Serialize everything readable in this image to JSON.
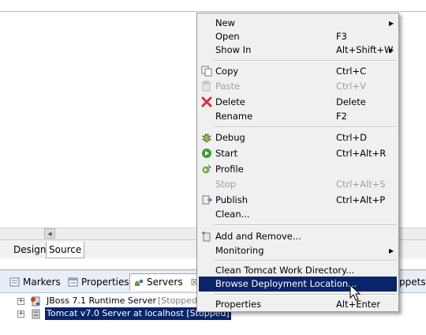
{
  "editor": {
    "tabs": [
      "Design",
      "Source"
    ]
  },
  "views": {
    "tabs": [
      {
        "label": "Markers",
        "icon": "markers-icon"
      },
      {
        "label": "Properties",
        "icon": "properties-icon"
      },
      {
        "label": "Servers",
        "icon": "servers-icon",
        "close": "☒"
      },
      {
        "label": "ppets",
        "icon": "snippets-icon"
      }
    ],
    "servers": [
      {
        "name": "JBoss 7.1 Runtime Server",
        "status": "[Stopped]",
        "expander": "+"
      },
      {
        "name": "Tomcat v7.0 Server at localhost",
        "status": "[Stopped]",
        "expander": "+"
      }
    ]
  },
  "context_menu": {
    "items": [
      {
        "label": "New",
        "accel": "",
        "submenu": true
      },
      {
        "label": "Open",
        "accel": "F3"
      },
      {
        "label": "Show In",
        "accel": "Alt+Shift+W",
        "submenu": true
      },
      {
        "label": "Copy",
        "accel": "Ctrl+C",
        "icon": "copy-icon"
      },
      {
        "label": "Paste",
        "accel": "Ctrl+V",
        "icon": "paste-icon",
        "disabled": true
      },
      {
        "label": "Delete",
        "accel": "Delete",
        "icon": "delete-icon"
      },
      {
        "label": "Rename",
        "accel": "F2"
      },
      {
        "label": "Debug",
        "accel": "Ctrl+D",
        "icon": "debug-icon"
      },
      {
        "label": "Start",
        "accel": "Ctrl+Alt+R",
        "icon": "start-icon"
      },
      {
        "label": "Profile",
        "accel": "",
        "icon": "profile-icon"
      },
      {
        "label": "Stop",
        "accel": "Ctrl+Alt+S",
        "icon": "stop-icon",
        "disabled": true
      },
      {
        "label": "Publish",
        "accel": "Ctrl+Alt+P",
        "icon": "publish-icon"
      },
      {
        "label": "Clean...",
        "accel": ""
      },
      {
        "label": "Add and Remove...",
        "accel": "",
        "icon": "add-remove-icon"
      },
      {
        "label": "Monitoring",
        "accel": "",
        "submenu": true
      },
      {
        "label": "Clean Tomcat Work Directory...",
        "accel": ""
      },
      {
        "label": "Browse Deployment Location...",
        "accel": "",
        "highlighted": true
      },
      {
        "label": "Properties",
        "accel": "Alt+Enter"
      }
    ],
    "submenu_arrow": "▶"
  },
  "colors": {
    "selection": "#0a246a",
    "menu_bg": "#f0f0f0",
    "disabled_text": "#a0a0a0"
  }
}
